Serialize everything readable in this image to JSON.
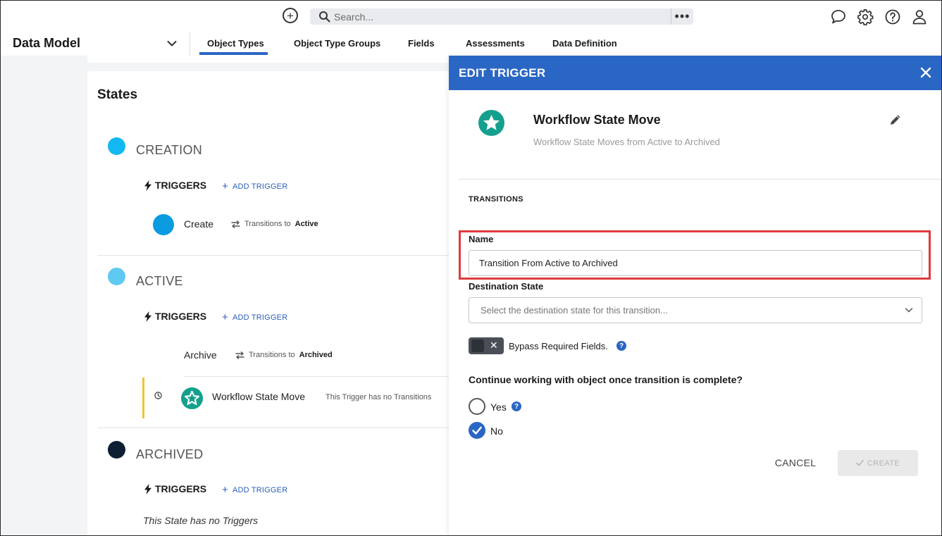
{
  "topbar": {
    "search_placeholder": "Search...",
    "more_label": "•••",
    "icons": [
      "add-icon",
      "search-icon",
      "chat-icon",
      "gear-icon",
      "help-icon",
      "user-icon"
    ]
  },
  "nav": {
    "module": "Data Model",
    "tabs": [
      {
        "label": "Object Types",
        "active": true
      },
      {
        "label": "Object Type Groups",
        "active": false
      },
      {
        "label": "Fields",
        "active": false
      },
      {
        "label": "Assessments",
        "active": false
      },
      {
        "label": "Data Definition",
        "active": false
      }
    ]
  },
  "states": {
    "title": "States",
    "triggers_label": "TRIGGERS",
    "add_trigger_label": "ADD TRIGGER",
    "list": [
      {
        "name": "CREATION",
        "color": "#13b8f0"
      },
      {
        "name": "ACTIVE",
        "color": "#5fc9f2"
      },
      {
        "name": "ARCHIVED",
        "color": "#0e1e33"
      }
    ],
    "creation_transition": {
      "name": "Create",
      "prefix": "Transitions to",
      "target": "Active"
    },
    "active_transition": {
      "name": "Archive",
      "prefix": "Transitions to",
      "target": "Archived"
    },
    "workflow_trigger": {
      "name": "Workflow State Move",
      "note": "This Trigger has no Transitions"
    },
    "archived_empty": "This State has no Triggers"
  },
  "panel": {
    "title": "EDIT TRIGGER",
    "trigger_name": "Workflow State Move",
    "trigger_desc": "Workflow State Moves from Active to Archived",
    "section": "TRANSITIONS",
    "name_label": "Name",
    "name_value": "Transition From Active to Archived",
    "dest_label": "Destination State",
    "dest_placeholder": "Select the destination state for this transition...",
    "bypass_label": "Bypass Required Fields.",
    "bypass_enabled": false,
    "question": "Continue working with object once transition is complete?",
    "yes_label": "Yes",
    "no_label": "No",
    "selected": "No",
    "cancel_label": "CANCEL",
    "create_label": "CREATE",
    "accent_color": "#2a66c4",
    "highlight_color": "#e0393e",
    "badge_color": "#15a08e"
  }
}
